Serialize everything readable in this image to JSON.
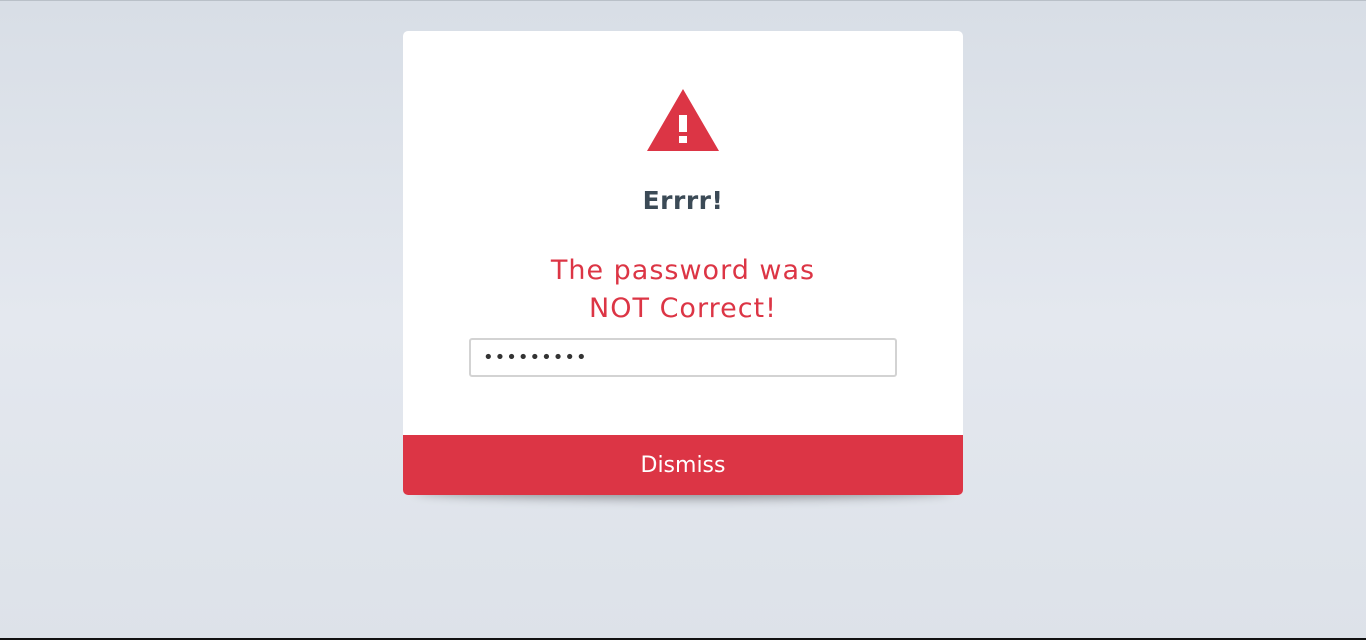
{
  "dialog": {
    "icon": "warning-triangle-icon",
    "title": "Errrr!",
    "message_line1": "The password was",
    "message_line2": "NOT Correct!",
    "password_value": "•••••••••",
    "dismiss_label": "Dismiss"
  },
  "colors": {
    "accent": "#dc3545",
    "title": "#3b4a56",
    "background": "#e2e6ec"
  }
}
